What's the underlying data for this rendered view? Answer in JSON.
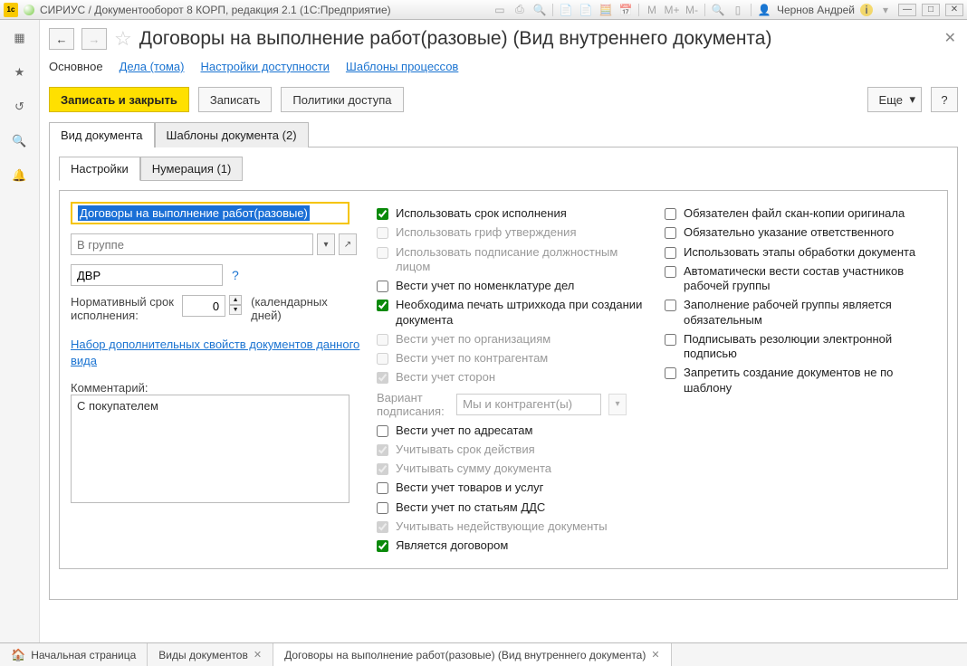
{
  "titlebar": {
    "title": "СИРИУС / Документооборот 8 КОРП, редакция 2.1  (1С:Предприятие)",
    "user": "Чернов Андрей"
  },
  "header": {
    "title": "Договоры на выполнение работ(разовые) (Вид внутреннего документа)"
  },
  "subnav": {
    "main": "Основное",
    "cases": "Дела (тома)",
    "access": "Настройки доступности",
    "templates": "Шаблоны процессов"
  },
  "cmd": {
    "save_close": "Записать и закрыть",
    "save": "Записать",
    "policies": "Политики доступа",
    "more": "Еще",
    "help": "?"
  },
  "top_tabs": {
    "doc_type": "Вид документа",
    "doc_templates": "Шаблоны документа (2)"
  },
  "inner_tabs": {
    "settings": "Настройки",
    "numbering": "Нумерация (1)"
  },
  "form": {
    "name_value": "Договоры на выполнение работ(разовые)",
    "group_placeholder": "В группе",
    "code_value": "ДВР",
    "norm_label": "Нормативный срок исполнения:",
    "norm_value": "0",
    "norm_unit": "(календарных дней)",
    "extra_link": "Набор дополнительных свойств документов данного вида",
    "comment_label": "Комментарий:",
    "comment_value": "С покупателем"
  },
  "checks_mid": [
    {
      "label": "Использовать срок исполнения",
      "checked": true,
      "disabled": false
    },
    {
      "label": "Использовать гриф утверждения",
      "checked": false,
      "disabled": true
    },
    {
      "label": "Использовать подписание должностным лицом",
      "checked": false,
      "disabled": true
    },
    {
      "label": "Вести учет по номенклатуре дел",
      "checked": false,
      "disabled": false
    },
    {
      "label": "Необходима печать штрихкода при создании документа",
      "checked": true,
      "disabled": false
    },
    {
      "label": "Вести учет по организациям",
      "checked": false,
      "disabled": true
    },
    {
      "label": "Вести учет по контрагентам",
      "checked": false,
      "disabled": true
    },
    {
      "label": "Вести учет сторон",
      "checked": true,
      "disabled": true
    }
  ],
  "sign_variant": {
    "label": "Вариант подписания:",
    "value": "Мы и контрагент(ы)"
  },
  "checks_mid2": [
    {
      "label": "Вести учет по адресатам",
      "checked": false,
      "disabled": false
    },
    {
      "label": "Учитывать срок действия",
      "checked": true,
      "disabled": true
    },
    {
      "label": "Учитывать сумму документа",
      "checked": true,
      "disabled": true
    },
    {
      "label": "Вести учет товаров и услуг",
      "checked": false,
      "disabled": false
    },
    {
      "label": "Вести учет по статьям ДДС",
      "checked": false,
      "disabled": false
    },
    {
      "label": "Учитывать недействующие документы",
      "checked": true,
      "disabled": true
    },
    {
      "label": "Является договором",
      "checked": true,
      "disabled": false
    }
  ],
  "checks_right": [
    {
      "label": "Обязателен файл скан-копии оригинала",
      "checked": false
    },
    {
      "label": "Обязательно указание ответственного",
      "checked": false
    },
    {
      "label": "Использовать этапы обработки документа",
      "checked": false
    },
    {
      "label": "Автоматически вести состав участников рабочей группы",
      "checked": false
    },
    {
      "label": "Заполнение рабочей группы является обязательным",
      "checked": false
    },
    {
      "label": "Подписывать резолюции электронной подписью",
      "checked": false
    },
    {
      "label": "Запретить создание документов не по шаблону",
      "checked": false
    }
  ],
  "bottombar": {
    "home": "Начальная страница",
    "t1": "Виды документов",
    "t2": "Договоры на выполнение работ(разовые) (Вид внутреннего документа)"
  }
}
